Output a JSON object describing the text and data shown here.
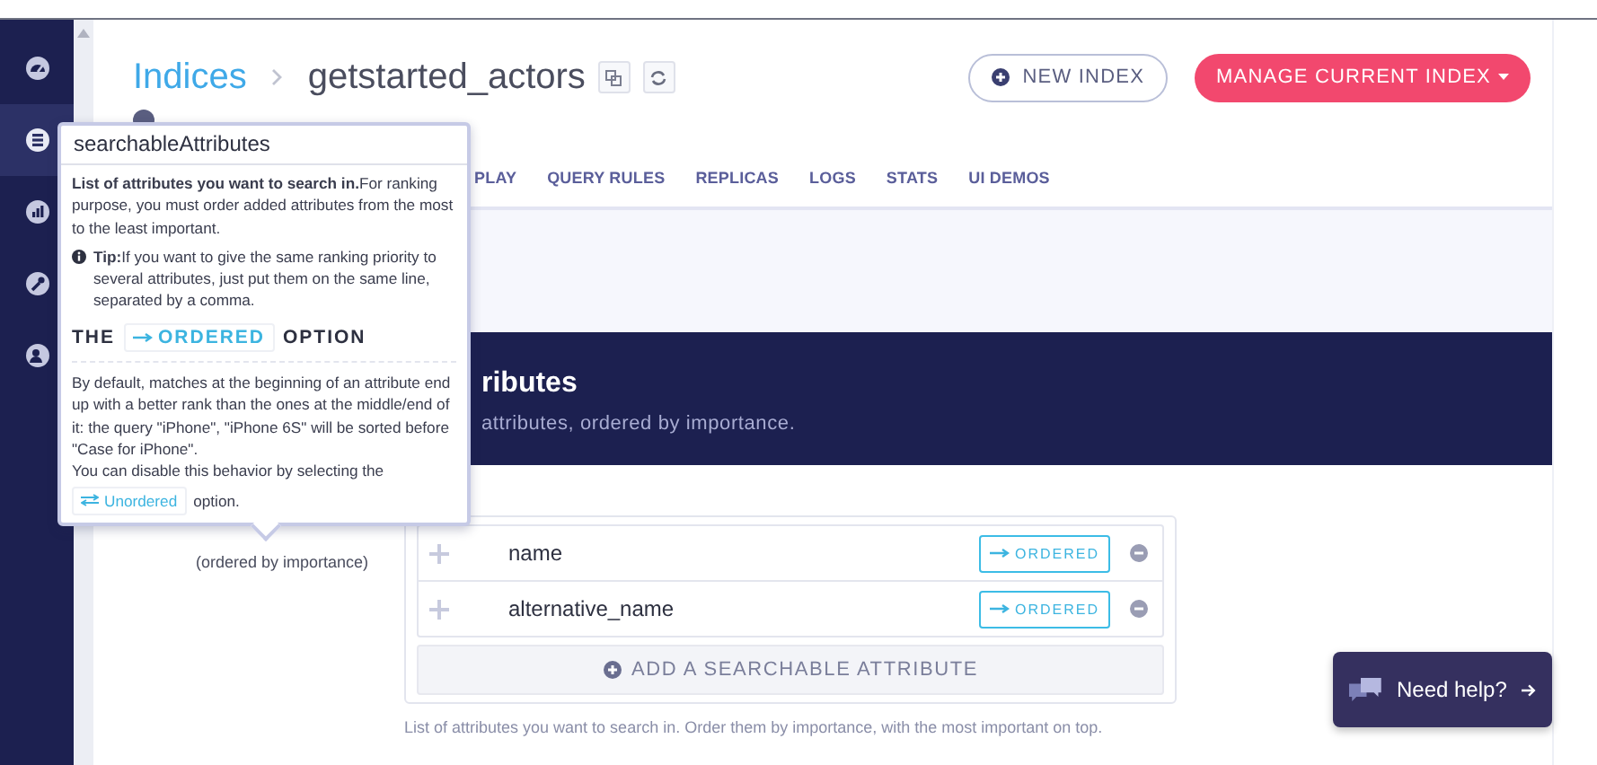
{
  "sidebar": {
    "items": [
      {
        "kind": "gauge",
        "selected": false
      },
      {
        "kind": "database",
        "selected": true
      },
      {
        "kind": "chart",
        "selected": false
      },
      {
        "kind": "wrench",
        "selected": false
      },
      {
        "kind": "users",
        "selected": false
      }
    ]
  },
  "header": {
    "breadcrumb": "Indices",
    "index_name": "getstarted_actors",
    "buttons": [
      {
        "label": "NEW INDEX",
        "kind": "outline"
      },
      {
        "label": "MANAGE CURRENT INDEX",
        "kind": "primary"
      }
    ]
  },
  "tabs": [
    {
      "label": "PLAY",
      "selected": false
    },
    {
      "label": "QUERY RULES",
      "selected": false
    },
    {
      "label": "REPLICAS",
      "selected": false
    },
    {
      "label": "LOGS",
      "selected": false
    },
    {
      "label": "STATS",
      "selected": false
    },
    {
      "label": "UI DEMOS",
      "selected": false
    }
  ],
  "section": {
    "title": "ributes",
    "subtitle": "attributes, ordered by importance."
  },
  "setting": {
    "label": "(ordered by importance)",
    "attributes": [
      {
        "name": "name",
        "mode": "ORDERED"
      },
      {
        "name": "alternative_name",
        "mode": "ORDERED"
      }
    ],
    "add_label": "ADD A SEARCHABLE ATTRIBUTE",
    "help": "List of attributes you want to search in. Order them by importance, with the most important on top."
  },
  "tooltip": {
    "title": "searchableAttributes",
    "intro": "**List of attributes you want to search in.**For ranking purpose, you must order added attributes from the most to the least important.",
    "tip": "**Tip:**If you want to give the same ranking priority to several attributes, just put them on the same line, separated by a comma.",
    "heading": {
      "before": "THE",
      "badge": "ORDERED",
      "after": "OPTION"
    },
    "paragraph": "By default, matches at the beginning of an attribute end up with a better rank than the ones at the middle/end of it: the query \"iPhone\", \"iPhone 6S\" will be sorted before \"Case for iPhone\".",
    "disable": {
      "before": "You can disable this behavior by selecting the",
      "badge": "Unordered",
      "after": "option."
    }
  },
  "help_button": {
    "label": "Need help?"
  }
}
